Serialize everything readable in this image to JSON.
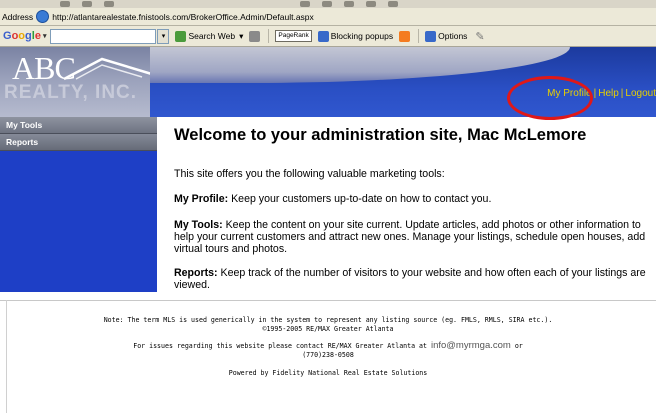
{
  "browser": {
    "address_label": "Address",
    "url": "http://atlantarealestate.fnistools.com/BrokerOffice.Admin/Default.aspx",
    "google_logo": "Google",
    "search_web_label": "Search Web",
    "pagerank_label": "PageRank",
    "blocking_label": "Blocking popups",
    "options_label": "Options"
  },
  "header": {
    "logo_line1": "ABC",
    "logo_line2": "REALTY, INC.",
    "links": {
      "my_profile": "My Profile",
      "help": "Help",
      "logout": "Logout",
      "separator": "|"
    },
    "band_color": "#2a4fc4",
    "link_color": "#e8d000",
    "annotation_color": "#e01818"
  },
  "sidebar": {
    "items": [
      {
        "label": "My Tools"
      },
      {
        "label": "Reports"
      }
    ],
    "color": "#1e3fc6"
  },
  "main": {
    "welcome": "Welcome to your administration site, Mac McLemore",
    "intro": "This site offers you the following valuable marketing tools:",
    "profile_title": "My Profile:",
    "profile_text": "Keep your customers up-to-date on how to contact you.",
    "tools_title": "My Tools:",
    "tools_text": "Keep the content on your site current. Update articles, add photos or other information to help your current customers and attract new ones. Manage your listings, schedule open houses, add virtual tours and photos.",
    "reports_title": "Reports:",
    "reports_text": "Keep track of the number of visitors to your website and how often each of your listings are viewed."
  },
  "footer": {
    "note_line1": "Note: The term MLS is used generically in the system to represent any listing source (eg. FMLS, RMLS, SIRA etc.).",
    "note_line2": "©1995-2005 RE/MAX Greater Atlanta",
    "contact_prefix": "For issues regarding this website please contact RE/MAX Greater Atlanta at",
    "contact_email": "info@myrmga.com",
    "contact_or": "or",
    "contact_phone": "(770)238-0508",
    "powered_by": "Powered by Fidelity National Real Estate Solutions"
  }
}
